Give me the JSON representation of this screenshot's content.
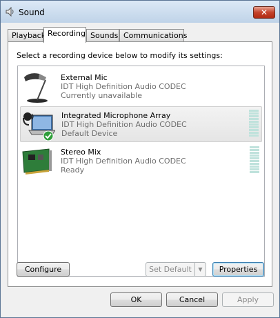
{
  "window": {
    "title": "Sound",
    "close_label": "✕"
  },
  "tabs": [
    {
      "label": "Playback",
      "active": false
    },
    {
      "label": "Recording",
      "active": true
    },
    {
      "label": "Sounds",
      "active": false
    },
    {
      "label": "Communications",
      "active": false
    }
  ],
  "instruction": "Select a recording device below to modify its settings:",
  "devices": [
    {
      "name": "External Mic",
      "driver": "IDT High Definition Audio CODEC",
      "status": "Currently unavailable",
      "icon": "microphone-icon",
      "selected": false
    },
    {
      "name": "Integrated Microphone Array",
      "driver": "IDT High Definition Audio CODEC",
      "status": "Default Device",
      "icon": "headset-laptop-icon",
      "selected": true,
      "default": true
    },
    {
      "name": "Stereo Mix",
      "driver": "IDT High Definition Audio CODEC",
      "status": "Ready",
      "icon": "sound-card-icon",
      "selected": false
    }
  ],
  "panel_buttons": {
    "configure": "Configure",
    "set_default": "Set Default",
    "properties": "Properties"
  },
  "dialog_buttons": {
    "ok": "OK",
    "cancel": "Cancel",
    "apply": "Apply"
  },
  "colors": {
    "level_meter": "#bfe2dc",
    "default_check": "#2f9e3a"
  }
}
